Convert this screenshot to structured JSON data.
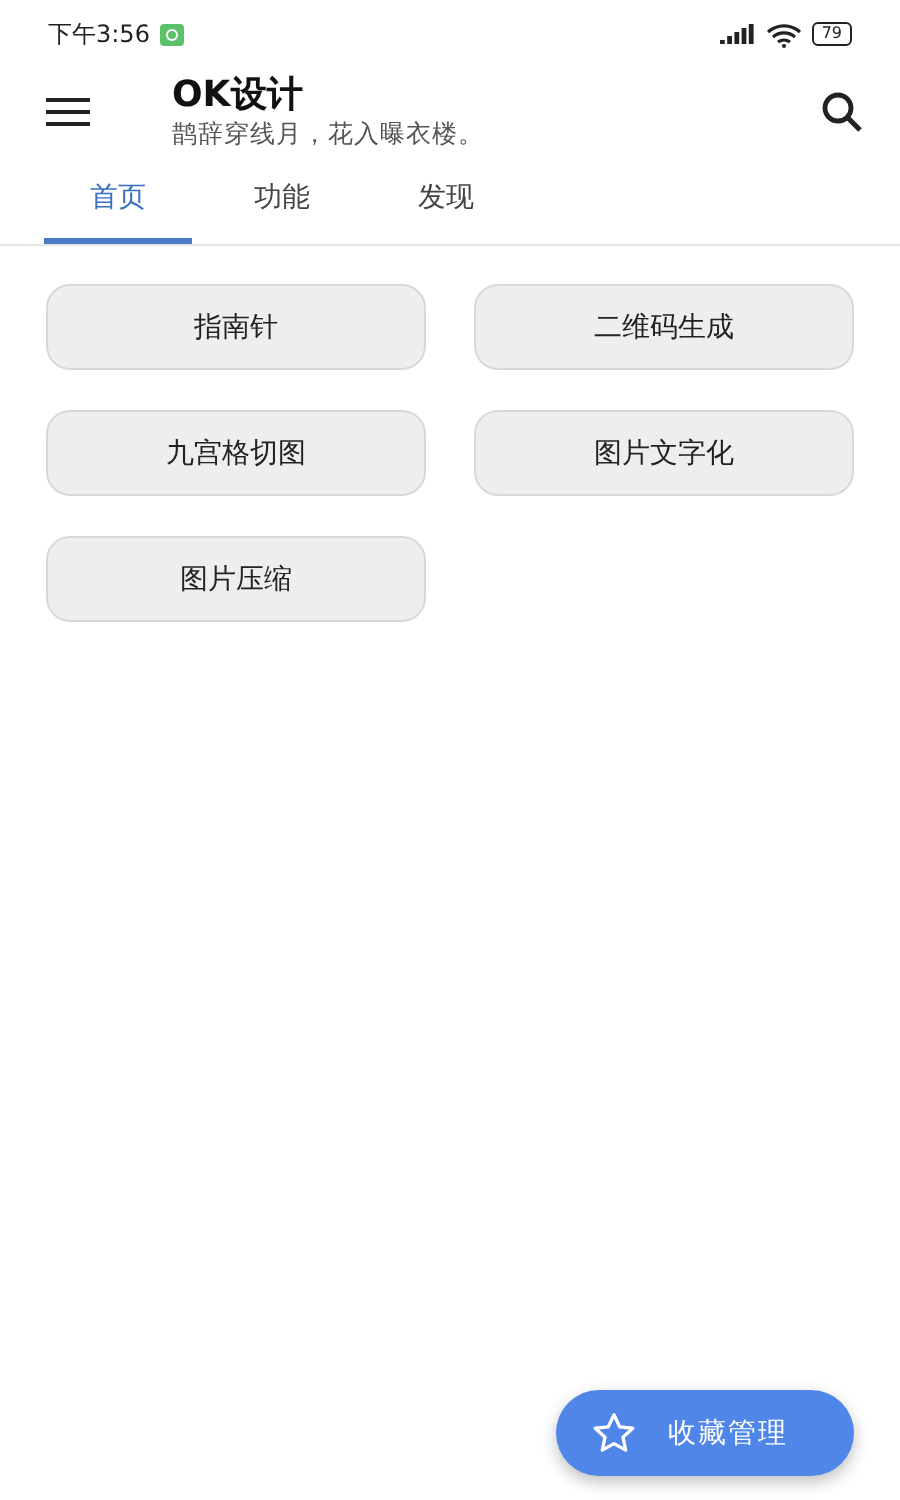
{
  "status_bar": {
    "time": "下午3:56",
    "battery": "79"
  },
  "header": {
    "title": "OK设计",
    "subtitle": "鹊辞穿线月，花入曝衣楼。"
  },
  "tabs": [
    {
      "label": "首页",
      "selected": true
    },
    {
      "label": "功能",
      "selected": false
    },
    {
      "label": "发现",
      "selected": false
    }
  ],
  "tools": [
    "指南针",
    "二维码生成",
    "九宫格切图",
    "图片文字化",
    "图片压缩"
  ],
  "fab": {
    "label": "收藏管理"
  }
}
